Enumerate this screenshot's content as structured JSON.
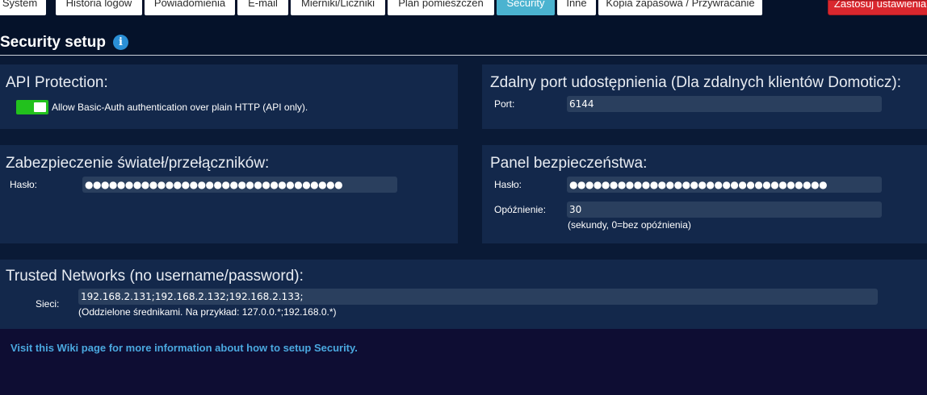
{
  "tabs": [
    {
      "label": "System",
      "active": false
    },
    {
      "label": "Historia logów",
      "active": false
    },
    {
      "label": "Powiadomienia",
      "active": false
    },
    {
      "label": "E-mail",
      "active": false
    },
    {
      "label": "Mierniki/Liczniki",
      "active": false
    },
    {
      "label": "Plan pomieszczeń",
      "active": false
    },
    {
      "label": "Security",
      "active": true
    },
    {
      "label": "Inne",
      "active": false
    },
    {
      "label": "Kopia zapasowa / Przywracanie",
      "active": false
    }
  ],
  "apply_button": {
    "label": "Zastosuj ustawienia"
  },
  "page": {
    "title": "Security setup",
    "info_icon": "info-icon"
  },
  "api_protection": {
    "title": "API Protection:",
    "toggle_on": true,
    "toggle_label": "Allow Basic-Auth authentication over plain HTTP (API only)."
  },
  "remote_port": {
    "title": "Zdalny port udostępnienia (Dla zdalnych klientów Domoticz):",
    "port_label": "Port:",
    "port_value": "6144"
  },
  "light_switch_protection": {
    "title": "Zabezpieczenie świateł/przełączników:",
    "password_label": "Hasło:",
    "password_value": "●●●●●●●●●●●●●●●●●●●●●●●●●●●●●●●●"
  },
  "security_panel": {
    "title": "Panel bezpieczeństwa:",
    "password_label": "Hasło:",
    "password_value": "●●●●●●●●●●●●●●●●●●●●●●●●●●●●●●●●",
    "delay_label": "Opóźnienie:",
    "delay_value": "30",
    "delay_hint": "(sekundy, 0=bez opóźnienia)"
  },
  "trusted_networks": {
    "title": "Trusted Networks (no username/password):",
    "networks_label": "Sieci:",
    "networks_value": "192.168.2.131;192.168.2.132;192.168.2.133;",
    "hint": "(Oddzielone średnikami. Na przykład: 127.0.0.*;192.168.0.*)"
  },
  "wiki_link": {
    "text": "Visit this Wiki page for more information about how to setup Security."
  },
  "colors": {
    "background": "#0e0d33",
    "panel": "#13284b",
    "active_tab": "#4bb3d0",
    "apply_button": "#d9272e",
    "toggle_on": "#22c11d",
    "link": "#4aa8df"
  }
}
